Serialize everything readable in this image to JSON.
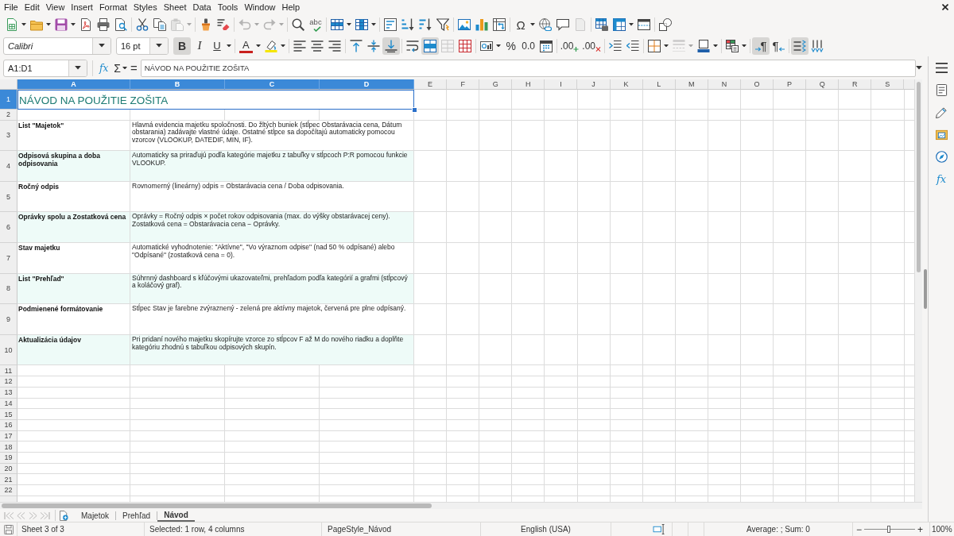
{
  "menu_bar": {
    "items": [
      "File",
      "Edit",
      "View",
      "Insert",
      "Format",
      "Styles",
      "Sheet",
      "Data",
      "Tools",
      "Window",
      "Help"
    ]
  },
  "standard_toolbar": {
    "groups": [
      [
        {
          "kind": "new",
          "dropdown": true,
          "disabled": false
        },
        {
          "kind": "open",
          "dropdown": true,
          "disabled": false
        },
        {
          "kind": "save",
          "dropdown": true,
          "disabled": false
        },
        {
          "kind": "pdf",
          "disabled": false
        },
        {
          "kind": "print",
          "disabled": false
        },
        {
          "kind": "preview",
          "disabled": false
        }
      ],
      [
        {
          "kind": "cut",
          "disabled": false
        },
        {
          "kind": "copy",
          "disabled": false
        },
        {
          "kind": "paste",
          "dropdown": true,
          "disabled": true
        }
      ],
      [
        {
          "kind": "brush",
          "disabled": false
        },
        {
          "kind": "eraser",
          "disabled": false
        }
      ],
      [
        {
          "kind": "undo",
          "dropdown": true,
          "disabled": true
        },
        {
          "kind": "redo",
          "dropdown": true,
          "disabled": true
        }
      ],
      [
        {
          "kind": "find",
          "disabled": false
        },
        {
          "kind": "spelling",
          "label": "abc",
          "disabled": false
        }
      ],
      [
        {
          "kind": "rows",
          "dropdown": true,
          "disabled": false
        },
        {
          "kind": "columns",
          "dropdown": true,
          "disabled": false
        }
      ],
      [
        {
          "kind": "sort",
          "disabled": false
        },
        {
          "kind": "ascending",
          "disabled": false
        },
        {
          "kind": "descending",
          "disabled": false
        },
        {
          "kind": "filter",
          "disabled": false
        }
      ],
      [
        {
          "kind": "image",
          "disabled": false
        },
        {
          "kind": "chart",
          "disabled": false
        },
        {
          "kind": "pivot",
          "disabled": false
        }
      ],
      [
        {
          "kind": "symbol",
          "label": "Ω",
          "dropdown": true,
          "disabled": false
        },
        {
          "kind": "link",
          "disabled": false
        },
        {
          "kind": "comment",
          "disabled": false
        },
        {
          "kind": "headerfooter",
          "disabled": true
        }
      ],
      [
        {
          "kind": "printarea",
          "disabled": false
        },
        {
          "kind": "freeze",
          "dropdown": true,
          "disabled": false
        },
        {
          "kind": "split",
          "disabled": false
        }
      ],
      [
        {
          "kind": "draw",
          "disabled": false
        }
      ]
    ]
  },
  "formatting_toolbar": {
    "font_name": "Calibri",
    "font_size": "16 pt",
    "groups": [
      [
        {
          "kind": "bold",
          "label": "B",
          "on": true,
          "disabled": false
        },
        {
          "kind": "italic",
          "label": "I",
          "on": false,
          "disabled": false
        },
        {
          "kind": "underline",
          "label": "U",
          "dropdown": true,
          "on": false,
          "disabled": false
        }
      ],
      [
        {
          "kind": "fontcolor",
          "label": "A",
          "dropdown": true,
          "on": false,
          "disabled": false
        },
        {
          "kind": "highlight",
          "dropdown": true,
          "on": false,
          "disabled": false
        }
      ],
      [
        {
          "kind": "alignleft",
          "on": false,
          "disabled": false
        },
        {
          "kind": "aligncenter",
          "on": false,
          "disabled": false
        },
        {
          "kind": "alignright",
          "on": false,
          "disabled": false
        }
      ],
      [
        {
          "kind": "aligntop",
          "on": false,
          "disabled": false
        },
        {
          "kind": "alignmiddle",
          "on": false,
          "disabled": false
        },
        {
          "kind": "alignbottom",
          "on": true,
          "disabled": false
        }
      ],
      [
        {
          "kind": "wrap",
          "on": false,
          "disabled": false
        },
        {
          "kind": "mergecenter",
          "on": true,
          "disabled": false
        },
        {
          "kind": "merge",
          "on": false,
          "disabled": true
        },
        {
          "kind": "unmerge",
          "on": false,
          "disabled": false
        }
      ],
      [
        {
          "kind": "currency",
          "dropdown": true,
          "on": false,
          "disabled": false
        },
        {
          "kind": "percent",
          "label": "%",
          "on": false,
          "disabled": false
        },
        {
          "kind": "number",
          "label": "0.0",
          "on": false,
          "disabled": false
        },
        {
          "kind": "date",
          "on": false,
          "disabled": false
        }
      ],
      [
        {
          "kind": "adddecimal",
          "label": ".00",
          "on": false,
          "disabled": false
        },
        {
          "kind": "deletedecimal",
          "label": ".00",
          "on": false,
          "disabled": false
        }
      ],
      [
        {
          "kind": "indent",
          "on": false,
          "disabled": false
        },
        {
          "kind": "outdent",
          "on": false,
          "disabled": false
        }
      ],
      [
        {
          "kind": "borders",
          "dropdown": true,
          "on": false,
          "disabled": false
        },
        {
          "kind": "borderstyle",
          "dropdown": true,
          "on": false,
          "disabled": true
        },
        {
          "kind": "bordercolor",
          "dropdown": true,
          "on": false,
          "disabled": false
        }
      ],
      [
        {
          "kind": "conditional",
          "dropdown": true,
          "on": false,
          "disabled": false
        }
      ],
      [
        {
          "kind": "ltr",
          "label": "¶",
          "on": true,
          "disabled": false
        },
        {
          "kind": "rtl",
          "label": "¶",
          "on": false,
          "disabled": false
        }
      ],
      [
        {
          "kind": "textleft",
          "on": true,
          "disabled": false
        },
        {
          "kind": "texttop",
          "on": false,
          "disabled": false
        }
      ]
    ]
  },
  "formula_bar": {
    "name_box": "A1:D1",
    "function_wizard": "fx",
    "sum": "Σ",
    "formula": "=",
    "content": "NÁVOD NA POUŽITIE ZOŠITA"
  },
  "sheet": {
    "columns": [
      {
        "label": "A",
        "selected": true
      },
      {
        "label": "B",
        "selected": true
      },
      {
        "label": "C",
        "selected": true
      },
      {
        "label": "D",
        "selected": true
      },
      {
        "label": "E",
        "selected": false
      },
      {
        "label": "F",
        "selected": false
      },
      {
        "label": "G",
        "selected": false
      },
      {
        "label": "H",
        "selected": false
      },
      {
        "label": "I",
        "selected": false
      },
      {
        "label": "J",
        "selected": false
      },
      {
        "label": "K",
        "selected": false
      },
      {
        "label": "L",
        "selected": false
      },
      {
        "label": "M",
        "selected": false
      },
      {
        "label": "N",
        "selected": false
      },
      {
        "label": "O",
        "selected": false
      },
      {
        "label": "P",
        "selected": false
      },
      {
        "label": "Q",
        "selected": false
      },
      {
        "label": "R",
        "selected": false
      },
      {
        "label": "S",
        "selected": false
      }
    ],
    "rows": [
      {
        "label": "1",
        "selected": true,
        "kind": "title",
        "text": "NÁVOD NA POUŽITIE ZOŠITA"
      },
      {
        "label": "2",
        "selected": false,
        "kind": "empty"
      },
      {
        "label": "3",
        "selected": false,
        "kind": "item",
        "shaded": false,
        "name": "List \"Majetok\"",
        "description": "Hlavná evidencia majetku spoločnosti. Do žltých buniek (stĺpec Obstarávacia cena, Dátum obstarania) zadávajte vlastné údaje. Ostatné stĺpce sa dopočítajú automaticky pomocou vzorcov (VLOOKUP, DATEDIF, MIN, IF)."
      },
      {
        "label": "4",
        "selected": false,
        "kind": "item",
        "shaded": true,
        "name": "Odpisová skupina a doba odpisovania",
        "description": "Automaticky sa priraďujú podľa kategórie majetku z tabuľky v stĺpcoch P:R pomocou funkcie VLOOKUP."
      },
      {
        "label": "5",
        "selected": false,
        "kind": "item",
        "shaded": false,
        "name": "Ročný odpis",
        "description": "Rovnomerný (lineárny) odpis = Obstarávacia cena / Doba odpisovania."
      },
      {
        "label": "6",
        "selected": false,
        "kind": "item",
        "shaded": true,
        "name": "Oprávky spolu a Zostatková cena",
        "description": "Oprávky = Ročný odpis × počet rokov odpisovania (max. do výšky obstarávacej ceny). Zostatková cena = Obstarávacia cena − Oprávky."
      },
      {
        "label": "7",
        "selected": false,
        "kind": "item",
        "shaded": false,
        "name": "Stav majetku",
        "description": "Automatické vyhodnotenie: \"Aktívne\", \"Vo výraznom odpise\" (nad 50 % odpísané) alebo \"Odpísané\" (zostatková cena = 0)."
      },
      {
        "label": "8",
        "selected": false,
        "kind": "item",
        "shaded": true,
        "name": "List \"Prehľad\"",
        "description": "Súhrnný dashboard s kľúčovými ukazovateľmi, prehľadom podľa kategórií a grafmi (stĺpcový a koláčový graf)."
      },
      {
        "label": "9",
        "selected": false,
        "kind": "item",
        "shaded": false,
        "name": "Podmienené formátovanie",
        "description": "Stĺpec Stav je farebne zvýraznený - zelená pre aktívny majetok, červená pre plne odpísaný."
      },
      {
        "label": "10",
        "selected": false,
        "kind": "item",
        "shaded": true,
        "name": "Aktualizácia údajov",
        "description": "Pri pridaní nového majetku skopírujte vzorce zo stĺpcov F až M do nového riadku a doplňte kategóriu zhodnú s tabuľkou odpisových skupín."
      },
      {
        "label": "11",
        "selected": false,
        "kind": "empty"
      },
      {
        "label": "12",
        "selected": false,
        "kind": "empty"
      },
      {
        "label": "13",
        "selected": false,
        "kind": "empty"
      },
      {
        "label": "14",
        "selected": false,
        "kind": "empty"
      },
      {
        "label": "15",
        "selected": false,
        "kind": "empty"
      },
      {
        "label": "16",
        "selected": false,
        "kind": "empty"
      },
      {
        "label": "17",
        "selected": false,
        "kind": "empty"
      },
      {
        "label": "18",
        "selected": false,
        "kind": "empty"
      },
      {
        "label": "19",
        "selected": false,
        "kind": "empty"
      },
      {
        "label": "20",
        "selected": false,
        "kind": "empty"
      },
      {
        "label": "21",
        "selected": false,
        "kind": "empty"
      },
      {
        "label": "22",
        "selected": false,
        "kind": "empty"
      }
    ]
  },
  "sidebar": {
    "functions_tab": "fx"
  },
  "sheet_tabs": {
    "navigation": [
      {
        "kind": "first",
        "disabled": true
      },
      {
        "kind": "previous",
        "disabled": true
      },
      {
        "kind": "next",
        "disabled": true
      },
      {
        "kind": "last",
        "disabled": true
      }
    ],
    "tabs": [
      {
        "label": "Majetok",
        "selected": false
      },
      {
        "label": "Prehľad",
        "selected": false
      },
      {
        "label": "Návod",
        "selected": true
      }
    ]
  },
  "status_bar": {
    "sheet": "Sheet 3 of 3",
    "selection": "Selected: 1 row, 4 columns",
    "page_style": "PageStyle_Návod",
    "language": "English (USA)",
    "summary": "Average: ; Sum: 0",
    "zoom": {
      "minus": "−",
      "plus": "+",
      "level": 0.48,
      "reading": "100%"
    }
  }
}
